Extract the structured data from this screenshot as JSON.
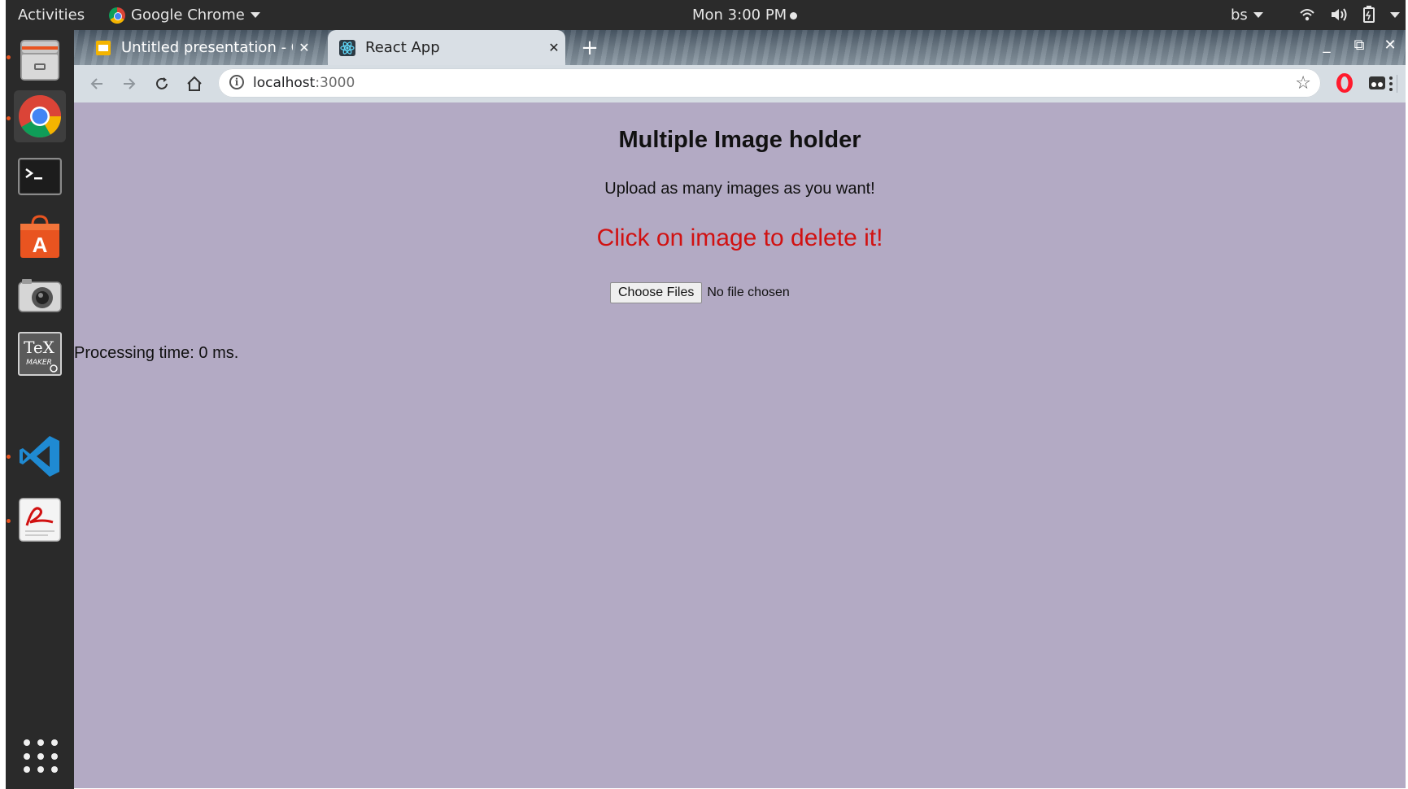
{
  "system_bar": {
    "activities": "Activities",
    "app_name": "Google Chrome",
    "clock": "Mon  3:00 PM",
    "keyboard_layout": "bs"
  },
  "browser": {
    "tabs": [
      {
        "title": "Untitled presentation - Go",
        "icon": "google-slides-icon",
        "active": false
      },
      {
        "title": "React App",
        "icon": "react-icon",
        "active": true
      }
    ],
    "url_host": "localhost",
    "url_port": ":3000"
  },
  "page": {
    "heading": "Multiple Image holder",
    "subtitle": "Upload as many images as you want!",
    "instruction": "Click on image to delete it!",
    "file_button": "Choose Files",
    "file_status": "No file chosen",
    "processing": "Processing time: 0 ms."
  },
  "colors": {
    "page_background": "#b3aac4",
    "instruction_text": "#d11111",
    "dock_background": "#2a2a2a",
    "top_bar": "#2b2b2b"
  },
  "dock_apps": [
    "files-icon",
    "chrome-icon",
    "terminal-icon",
    "software-center-icon",
    "camera-icon",
    "texmaker-icon",
    "vscode-icon",
    "pdf-viewer-icon",
    "show-applications-icon"
  ]
}
